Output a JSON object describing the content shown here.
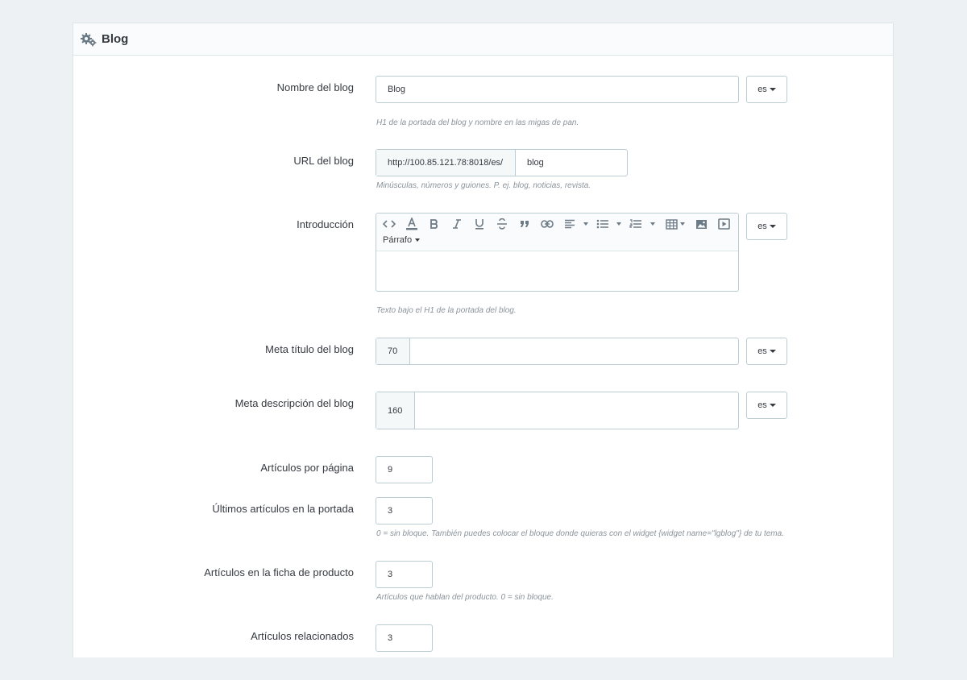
{
  "panel": {
    "title": "Blog",
    "icon": "cogs-icon"
  },
  "fields": {
    "blog_name": {
      "label": "Nombre del blog",
      "value": "Blog",
      "lang": "es",
      "help": "H1 de la portada del blog y nombre en las migas de pan."
    },
    "blog_url": {
      "label": "URL del blog",
      "prefix": "http://100.85.121.78:8018/es/",
      "value": "blog",
      "help": "Minúsculas, números y guiones. P. ej. blog, noticias, revista."
    },
    "intro": {
      "label": "Introducción",
      "lang": "es",
      "format": "Párrafo",
      "help": "Texto bajo el H1 de la portada del blog."
    },
    "meta_title": {
      "label": "Meta título del blog",
      "counter": "70",
      "value": "",
      "lang": "es"
    },
    "meta_desc": {
      "label": "Meta descripción del blog",
      "counter": "160",
      "value": "",
      "lang": "es"
    },
    "per_page": {
      "label": "Artículos por página",
      "value": "9"
    },
    "latest_home": {
      "label": "Últimos artículos en la portada",
      "value": "3",
      "help": "0 = sin bloque. También puedes colocar el bloque donde quieras con el widget {widget name=\"lgblog\"} de tu tema."
    },
    "product_page": {
      "label": "Artículos en la ficha de producto",
      "value": "3",
      "help": "Artículos que hablan del producto. 0 = sin bloque."
    },
    "related": {
      "label": "Artículos relacionados",
      "value": "3"
    }
  },
  "toolbar_icons": [
    "code-icon",
    "font-color-icon",
    "bold-icon",
    "italic-icon",
    "underline-icon",
    "strikethrough-icon",
    "quote-icon",
    "link-icon",
    "align-icon",
    "bullet-list-icon",
    "numbered-list-icon",
    "table-icon",
    "image-icon",
    "video-icon"
  ],
  "colors": {
    "background": "#edf1f4",
    "border": "#bbcdd2",
    "text": "#363a41",
    "help": "#8a939b"
  }
}
